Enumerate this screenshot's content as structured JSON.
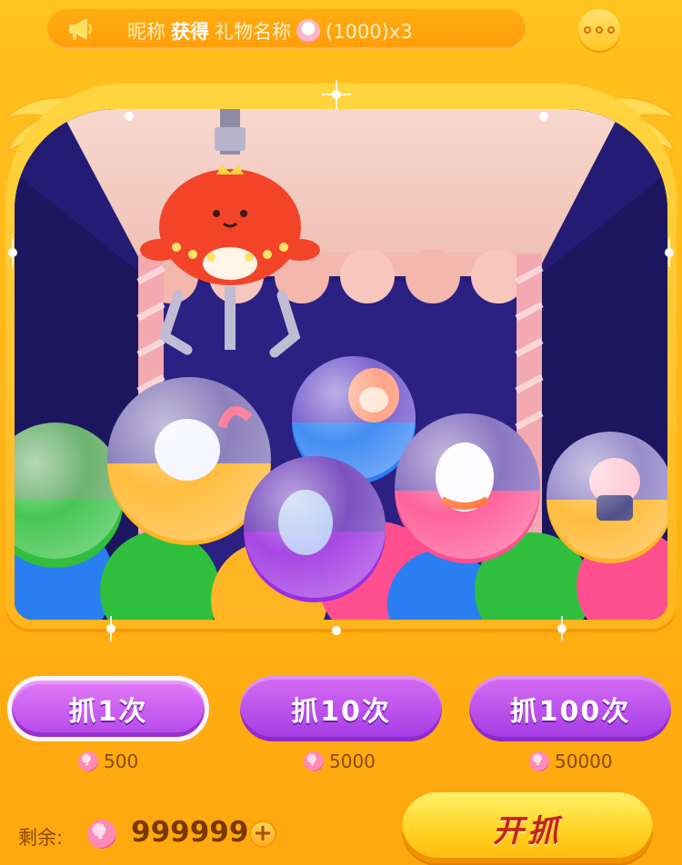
{
  "announcement": {
    "icon": "megaphone-icon",
    "nickname": "昵称",
    "verb": "获得",
    "gift_name": "礼物名称",
    "gift_icon": "unicorn-gift-icon",
    "gift_value": "(1000)x3"
  },
  "menu": {
    "icon": "more-dots-icon"
  },
  "machine": {
    "claw": "crab-claw",
    "capsules": [
      {
        "name": "capsule-forest-scene",
        "color": "#2fbf3d"
      },
      {
        "name": "capsule-seal-flamingo",
        "color": "#ffb424"
      },
      {
        "name": "capsule-alpaca",
        "color": "#2a7ef2"
      },
      {
        "name": "capsule-deer-forest",
        "color": "#9b2ee0"
      },
      {
        "name": "capsule-white-horse",
        "color": "#ff4f8f"
      },
      {
        "name": "capsule-pink-pig",
        "color": "#ffb424"
      }
    ]
  },
  "grab_options": [
    {
      "label": "抓1次",
      "price": "500",
      "selected": true
    },
    {
      "label": "抓10次",
      "price": "5000",
      "selected": false
    },
    {
      "label": "抓100次",
      "price": "50000",
      "selected": false
    }
  ],
  "balance": {
    "label": "剩余:",
    "value": "999999",
    "coin_icon": "music-note-coin-icon"
  },
  "start_button": {
    "label": "开抓"
  },
  "colors": {
    "background": "#ffb214",
    "button_purple": "#b447ea",
    "start_yellow": "#ffcf1d",
    "start_text": "#c2231a"
  }
}
